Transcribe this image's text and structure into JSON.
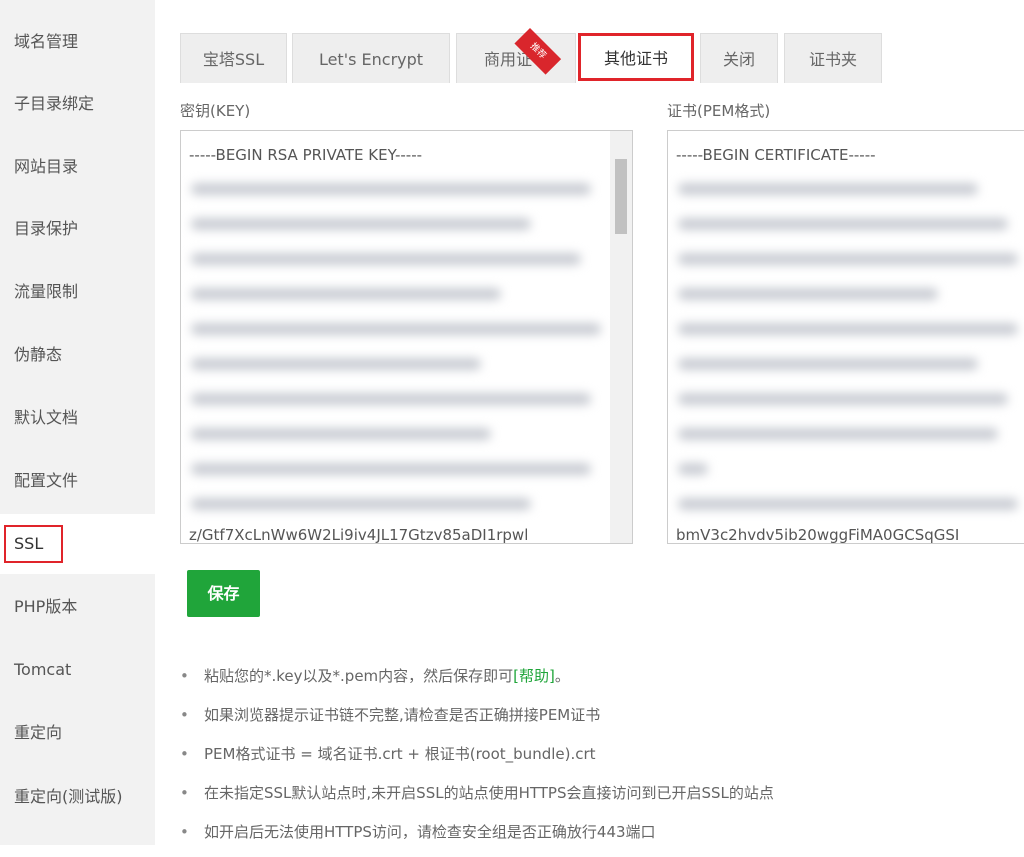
{
  "sidebar": {
    "items": [
      {
        "label": "域名管理"
      },
      {
        "label": "子目录绑定"
      },
      {
        "label": "网站目录"
      },
      {
        "label": "目录保护"
      },
      {
        "label": "流量限制"
      },
      {
        "label": "伪静态"
      },
      {
        "label": "默认文档"
      },
      {
        "label": "配置文件"
      },
      {
        "label": "SSL",
        "active": true
      },
      {
        "label": "PHP版本"
      },
      {
        "label": "Tomcat"
      },
      {
        "label": "重定向"
      },
      {
        "label": "重定向(测试版)"
      }
    ]
  },
  "tabs": [
    {
      "label": "宝塔SSL"
    },
    {
      "label": "Let's Encrypt"
    },
    {
      "label": "商用证书",
      "ribbon": "推荐"
    },
    {
      "label": "其他证书",
      "active": true
    },
    {
      "label": "关闭"
    },
    {
      "label": "证书夹"
    }
  ],
  "key": {
    "label": "密钥(KEY)",
    "first_line": "-----BEGIN RSA PRIVATE KEY-----",
    "last_line": "z/Gtf7XcLnWw6W2Li9iv4JL17Gtzv85aDI1rpwl"
  },
  "cert": {
    "label": "证书(PEM格式)",
    "first_line": "-----BEGIN CERTIFICATE-----",
    "last_line": "bmV3c2hvdv5ib20wggFiMA0GCSqGSI"
  },
  "save_label": "保存",
  "tips": [
    {
      "text": "粘贴您的*.key以及*.pem内容，然后保存即可",
      "link": "[帮助]",
      "after": "。"
    },
    {
      "text": "如果浏览器提示证书链不完整,请检查是否正确拼接PEM证书"
    },
    {
      "text": "PEM格式证书 = 域名证书.crt + 根证书(root_bundle).crt"
    },
    {
      "text": "在未指定SSL默认站点时,未开启SSL的站点使用HTTPS会直接访问到已开启SSL的站点"
    },
    {
      "text": "如开启后无法使用HTTPS访问，请检查安全组是否正确放行443端口"
    }
  ],
  "colors": {
    "accent": "#20a53a",
    "highlight": "#e0242a"
  }
}
